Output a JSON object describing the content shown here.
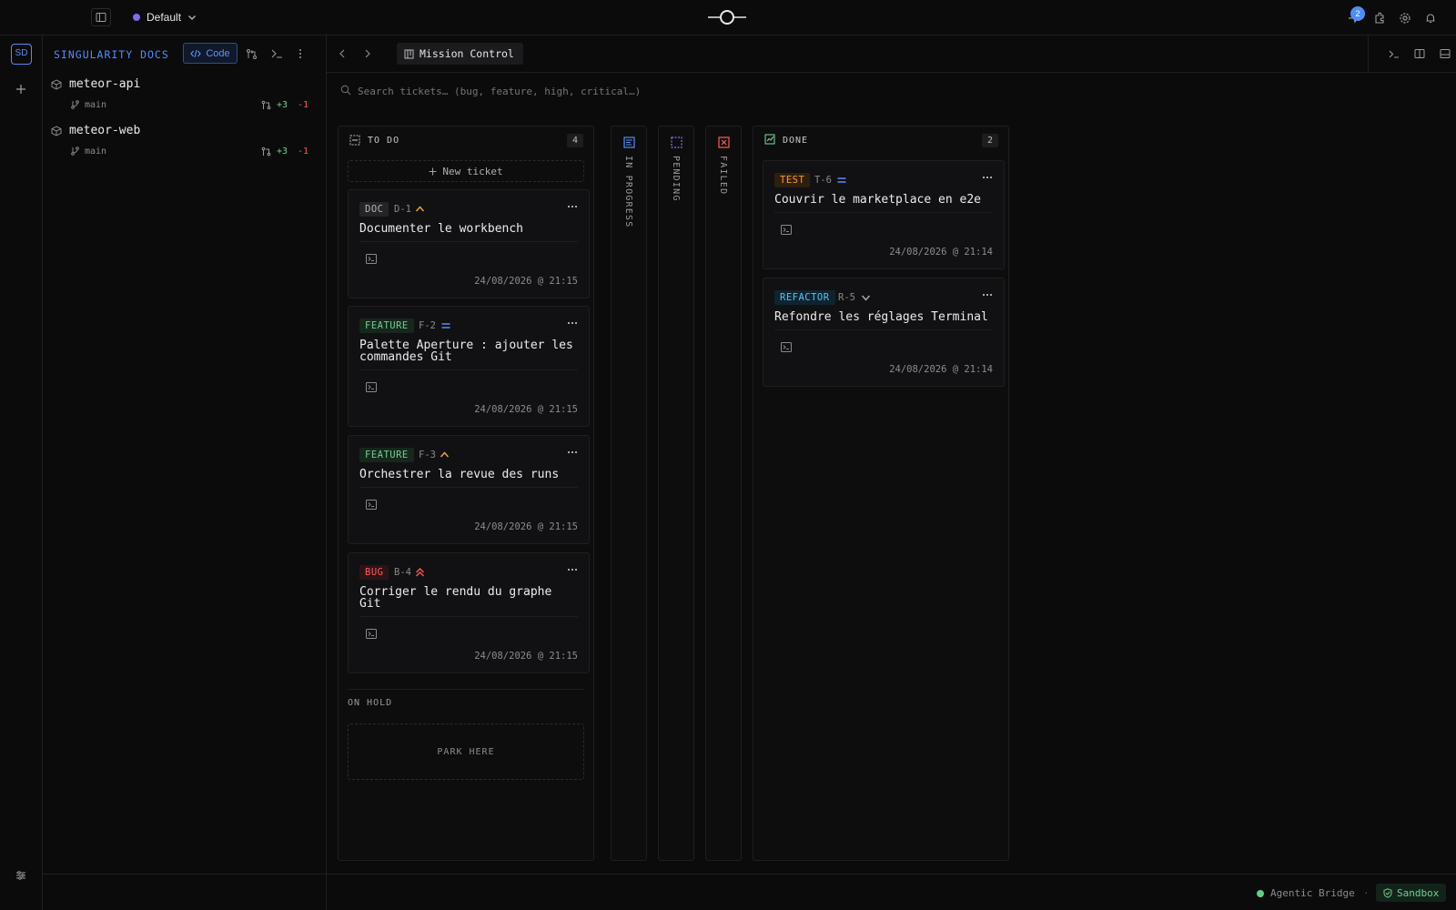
{
  "workspace": {
    "name": "Default",
    "dot_color": "#7c6cf0"
  },
  "notifications": {
    "badge": "2"
  },
  "sidebar": {
    "avatar": "SD",
    "title": "SINGULARITY DOCS",
    "code_button": "Code",
    "repos": [
      {
        "name": "meteor-api",
        "branch": "main",
        "added": "+3",
        "removed": "-1"
      },
      {
        "name": "meteor-web",
        "branch": "main",
        "added": "+3",
        "removed": "-1"
      }
    ]
  },
  "tab": {
    "label": "Mission Control"
  },
  "search": {
    "placeholder": "Search tickets… (bug, feature, high, critical…)"
  },
  "columns": {
    "todo": {
      "label": "TO DO",
      "count": "4",
      "new_ticket": "New ticket"
    },
    "in_progress": {
      "label": "IN PROGRESS"
    },
    "pending": {
      "label": "PENDING"
    },
    "failed": {
      "label": "FAILED"
    },
    "done": {
      "label": "DONE",
      "count": "2"
    }
  },
  "todo_cards": [
    {
      "tag": "DOC",
      "id": "D-1",
      "priority": "high",
      "title": "Documenter le workbench",
      "date": "24/08/2026 @ 21:15"
    },
    {
      "tag": "FEATURE",
      "id": "F-2",
      "priority": "medium",
      "title": "Palette Aperture : ajouter les commandes Git",
      "date": "24/08/2026 @ 21:15"
    },
    {
      "tag": "FEATURE",
      "id": "F-3",
      "priority": "high",
      "title": "Orchestrer la revue des runs",
      "date": "24/08/2026 @ 21:15"
    },
    {
      "tag": "BUG",
      "id": "B-4",
      "priority": "critical",
      "title": "Corriger le rendu du graphe Git",
      "date": "24/08/2026 @ 21:15"
    }
  ],
  "done_cards": [
    {
      "tag": "TEST",
      "id": "T-6",
      "priority": "medium",
      "title": "Couvrir le marketplace en e2e",
      "date": "24/08/2026 @ 21:14"
    },
    {
      "tag": "REFACTOR",
      "id": "R-5",
      "priority": "low",
      "title": "Refondre les réglages Terminal",
      "date": "24/08/2026 @ 21:14"
    }
  ],
  "on_hold": {
    "label": "ON HOLD",
    "drop_zone": "PARK HERE"
  },
  "status": {
    "bridge": "Agentic Bridge",
    "separator": "·",
    "sandbox": "Sandbox"
  },
  "colors": {
    "accent": "#4f8df7",
    "doc": "#a8a8a8",
    "feature": "#6fcf8f",
    "bug": "#ff5a5a",
    "test": "#ff9a2e",
    "refactor": "#5cc4f0",
    "priority_high": "#f0a030",
    "priority_critical": "#ff5a5a",
    "priority_medium": "#5b8df5",
    "added": "#6fcf8f",
    "removed": "#ff5a5a"
  }
}
